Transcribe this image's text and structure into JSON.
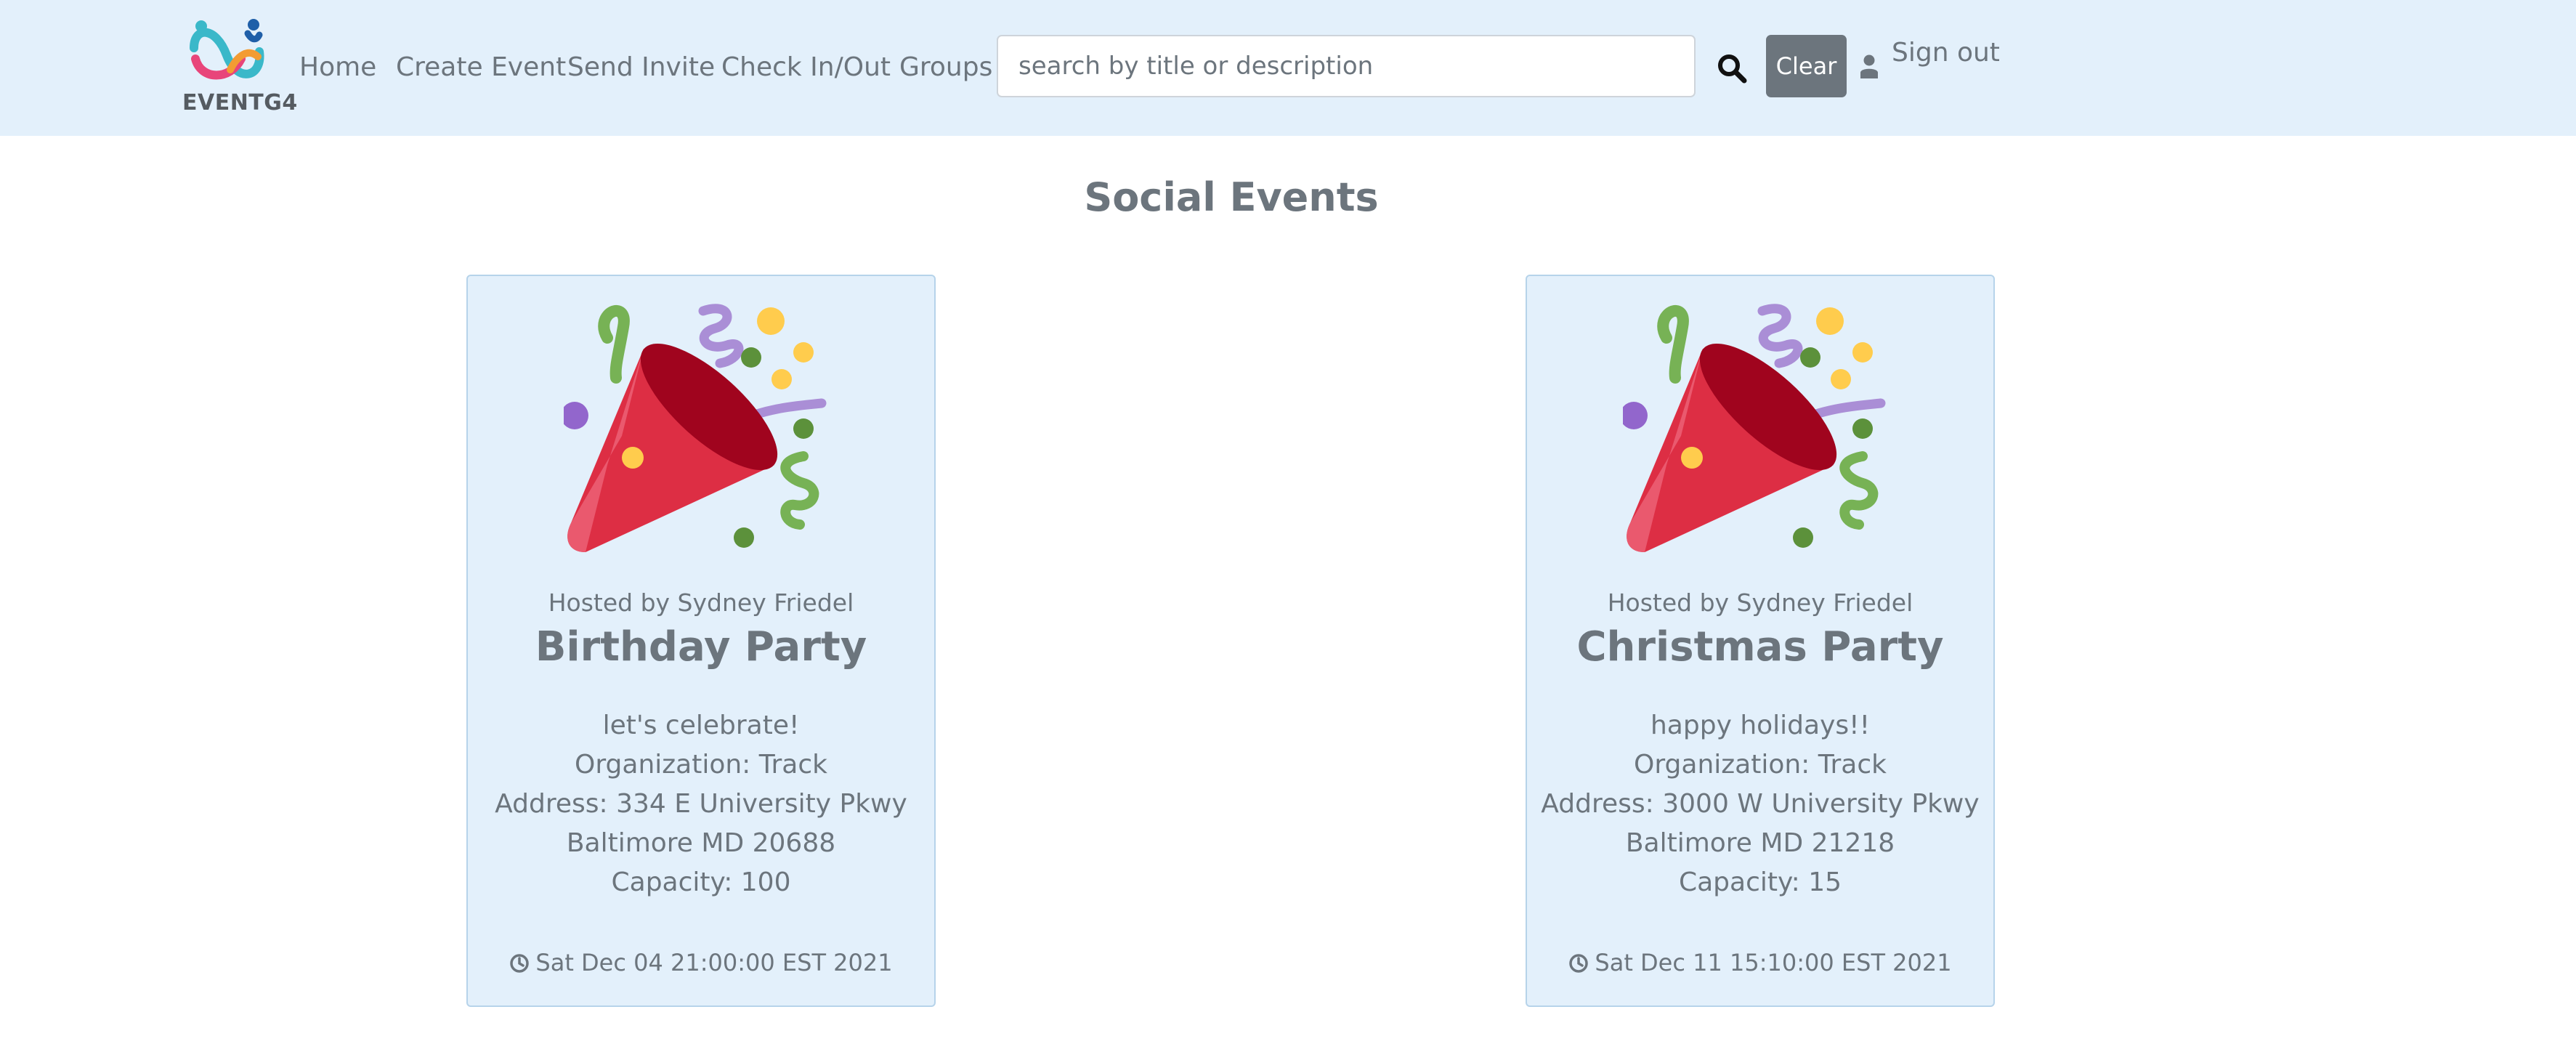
{
  "brand": {
    "name": "EVENTG4"
  },
  "nav": {
    "items": [
      {
        "label": "Home"
      },
      {
        "label": "Create Event"
      },
      {
        "label": "Send Invite"
      },
      {
        "label": "Check In/Out"
      },
      {
        "label": "Groups"
      }
    ],
    "search": {
      "placeholder": "search by title or description",
      "value": ""
    },
    "clear_label": "Clear",
    "signout_label": "Sign out"
  },
  "page": {
    "title": "Social Events"
  },
  "events": [
    {
      "host": "Hosted by Sydney Friedel",
      "title": "Birthday Party",
      "description": "let's celebrate!",
      "organization": "Organization: Track",
      "address_line1": "Address: 334 E University Pkwy",
      "address_line2": "Baltimore MD 20688",
      "capacity": "Capacity: 100",
      "date": "Sat Dec 04 21:00:00 EST 2021",
      "icon": "party-popper-icon"
    },
    {
      "host": "Hosted by Sydney Friedel",
      "title": "Christmas Party",
      "description": "happy holidays!!",
      "organization": "Organization: Track",
      "address_line1": "Address: 3000 W University Pkwy",
      "address_line2": "Baltimore MD 21218",
      "capacity": "Capacity: 15",
      "date": "Sat Dec 11 15:10:00 EST 2021",
      "icon": "party-popper-icon"
    }
  ],
  "colors": {
    "navbar_bg": "#e3f0fb",
    "card_bg": "#e3f0fb",
    "card_border": "#b6d3ea",
    "text": "#6c757d",
    "clear_button": "#6c757d"
  }
}
